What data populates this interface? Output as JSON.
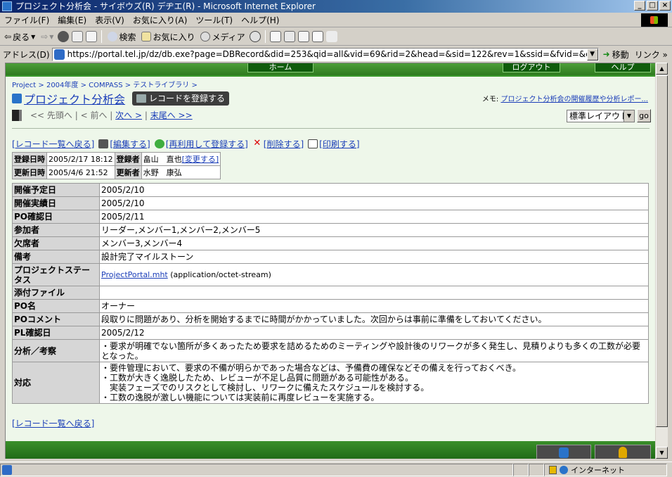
{
  "window": {
    "title": "プロジェクト分析会 - サイボウズ(R) デヂエ(R) - Microsoft Internet Explorer",
    "buttons": [
      "_",
      "□",
      "×"
    ]
  },
  "menu": [
    "ファイル(F)",
    "編集(E)",
    "表示(V)",
    "お気に入り(A)",
    "ツール(T)",
    "ヘルプ(H)"
  ],
  "toolbar": {
    "back": "戻る",
    "search": "検索",
    "favorites": "お気に入り",
    "media": "メディア"
  },
  "address": {
    "label": "アドレス(D)",
    "url": "https://portal.tel.jp/dz/db.exe?page=DBRecord&did=253&qid=all&vid=69&rid=2&head=&sid=122&rev=1&ssid=&fvid=&cal=lst",
    "go": "移動",
    "links": "リンク »"
  },
  "site_nav": [
    "ホーム",
    "ログアウト",
    "ヘルプ"
  ],
  "breadcrumb": "Project > 2004年度 > COMPASS > テストライブラリ >",
  "project_title": "プロジェクト分析会",
  "register_button": "レコードを登録する",
  "memo": {
    "label": "メモ:",
    "text": "プロジェクト分析会の開催履歴や分析レポー..."
  },
  "pager": {
    "first": "<< 先頭へ",
    "prev": "< 前へ",
    "next": "次へ >",
    "last": "末尾へ >>"
  },
  "layout_select": {
    "value": "標準レイアウト",
    "go": "go"
  },
  "actions": {
    "back_list": "[レコード一覧へ戻る]",
    "edit": "[編集する]",
    "reuse": "[再利用して登録する]",
    "delete": "[削除する]",
    "print": "[印刷する]"
  },
  "meta": {
    "created_label": "登録日時",
    "created_value": "2005/2/17 18:12",
    "creator_label": "登録者",
    "creator_value": "畠山　直也",
    "change_link": "[変更する]",
    "updated_label": "更新日時",
    "updated_value": "2005/4/6 21:52",
    "updater_label": "更新者",
    "updater_value": "水野　康弘"
  },
  "record": {
    "rows": [
      {
        "label": "開催予定日",
        "value": "2005/2/10"
      },
      {
        "label": "開催実績日",
        "value": "2005/2/10"
      },
      {
        "label": "PO確認日",
        "value": "2005/2/11"
      },
      {
        "label": "参加者",
        "value": "リーダー,メンバー1,メンバー2,メンバー5"
      },
      {
        "label": "欠席者",
        "value": "メンバー3,メンバー4"
      },
      {
        "label": "備考",
        "value": "設計完了マイルストーン"
      },
      {
        "label": "プロジェクトステータス",
        "link": "ProjectPortal.mht",
        "value": " (application/octet-stream)"
      },
      {
        "label": "添付ファイル",
        "value": ""
      },
      {
        "label": "PO名",
        "value": "オーナー"
      },
      {
        "label": "POコメント",
        "value": "段取りに問題があり、分析を開始するまでに時間がかかっていました。次回からは事前に準備をしておいてください。"
      },
      {
        "label": "PL確認日",
        "value": "2005/2/12"
      },
      {
        "label": "分析／考察",
        "value": "・要求が明確でない箇所が多くあったため要求を詰めるためのミーティングや設計後のリワークが多く発生し、見積りよりも多くの工数が必要となった。"
      },
      {
        "label": "対応",
        "lines": [
          "・要件管理において、要求の不備が明らかであった場合などは、予備費の確保などその備えを行っておくべき。",
          "・工数が大きく逸脱したため、レビューが不足し品質に問題がある可能性がある。",
          "　実装フェーズでのリスクとして検討し、リワークに備えたスケジュールを検討する。",
          "・工数の逸脱が激しい機能については実装前に再度レビューを実施する。"
        ]
      }
    ]
  },
  "back_bottom": "[レコード一覧へ戻る]",
  "status": {
    "zone": "インターネット"
  }
}
